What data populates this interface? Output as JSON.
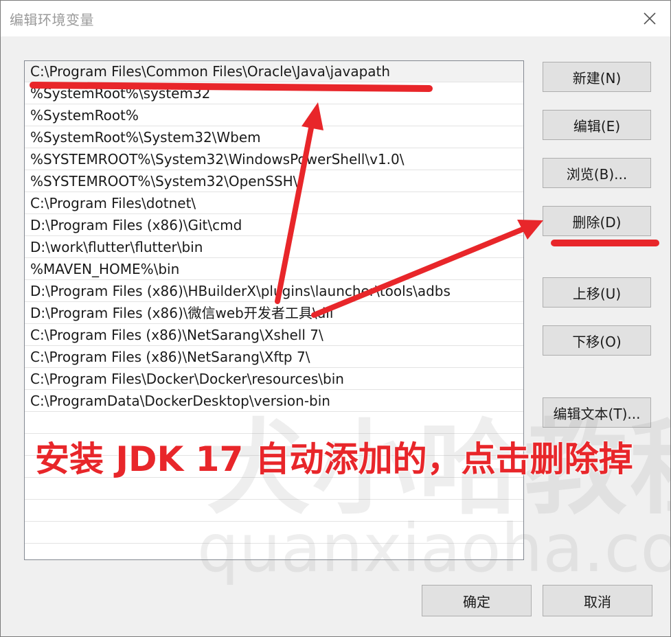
{
  "window": {
    "title": "编辑环境变量",
    "close_icon": "close-icon"
  },
  "path_list": {
    "selected_index": 0,
    "items": [
      "C:\\Program Files\\Common Files\\Oracle\\Java\\javapath",
      "%SystemRoot%\\system32",
      "%SystemRoot%",
      "%SystemRoot%\\System32\\Wbem",
      "%SYSTEMROOT%\\System32\\WindowsPowerShell\\v1.0\\",
      "%SYSTEMROOT%\\System32\\OpenSSH\\",
      "C:\\Program Files\\dotnet\\",
      "D:\\Program Files (x86)\\Git\\cmd",
      "D:\\work\\flutter\\flutter\\bin",
      "%MAVEN_HOME%\\bin",
      "D:\\Program Files (x86)\\HBuilderX\\plugins\\launcher\\tools\\adbs",
      "D:\\Program Files (x86)\\微信web开发者工具\\dll",
      "C:\\Program Files (x86)\\NetSarang\\Xshell 7\\",
      "C:\\Program Files (x86)\\NetSarang\\Xftp 7\\",
      "C:\\Program Files\\Docker\\Docker\\resources\\bin",
      "C:\\ProgramData\\DockerDesktop\\version-bin"
    ]
  },
  "buttons": {
    "new": "新建(N)",
    "edit": "编辑(E)",
    "browse": "浏览(B)...",
    "delete": "删除(D)",
    "move_up": "上移(U)",
    "move_down": "下移(O)",
    "edit_text": "编辑文本(T)...",
    "ok": "确定",
    "cancel": "取消"
  },
  "annotation": {
    "text": "安装 JDK 17 自动添加的，点击删除掉",
    "color": "#e8262a"
  },
  "watermark": {
    "chinese": "犬小哈教程",
    "url": "quanxiaoha.com"
  }
}
